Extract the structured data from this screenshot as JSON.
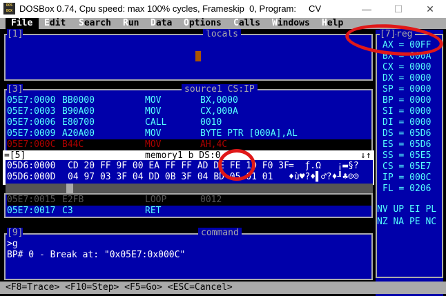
{
  "window": {
    "icon_text": "DOS BOX",
    "title": "DOSBox 0.74, Cpu speed: max 100% cycles, Frameskip  0, Program:     CV",
    "minimize_glyph": "—",
    "maximize_glyph": "☐",
    "close_glyph": "✕"
  },
  "menu": [
    {
      "hot": "F",
      "rest": "ile"
    },
    {
      "hot": "E",
      "rest": "dit"
    },
    {
      "hot": "S",
      "rest": "earch"
    },
    {
      "hot": "R",
      "rest": "un"
    },
    {
      "hot": "D",
      "rest": "ata"
    },
    {
      "hot": "O",
      "rest": "ptions"
    },
    {
      "hot": "C",
      "rest": "alls"
    },
    {
      "hot": "W",
      "rest": "indows"
    },
    {
      "hot": "H",
      "rest": "elp"
    }
  ],
  "locals": {
    "number": "[1]",
    "title": "locals"
  },
  "source": {
    "number": "[3]",
    "title": "source1 CS:IP",
    "lines": [
      {
        "addr": "05E7:0000",
        "bytes": "BB0000",
        "op": "MOV",
        "args": "BX,0000"
      },
      {
        "addr": "05E7:0003",
        "bytes": "B90A00",
        "op": "MOV",
        "args": "CX,000A"
      },
      {
        "addr": "05E7:0006",
        "bytes": "E80700",
        "op": "CALL",
        "args": "0010"
      },
      {
        "addr": "05E7:0009",
        "bytes": "A20A00",
        "op": "MOV",
        "args": "BYTE PTR [000A],AL"
      },
      {
        "addr": "05E7:000C",
        "bytes": "B44C",
        "op": "MOV",
        "args": "AH,4C"
      }
    ],
    "lines_after": [
      {
        "addr": "05E7:0015",
        "bytes": "E2FB",
        "op": "LOOP",
        "args": "0012"
      },
      {
        "addr": "05E7:0017",
        "bytes": "C3",
        "op": "RET",
        "args": ""
      }
    ]
  },
  "memory": {
    "number": "=[5]",
    "title": "memory1 b DS:0",
    "scroll": "↓↑",
    "lines": [
      {
        "addr": "05D6:0000",
        "hex": "CD 20 FF 9F 00 EA FF FF AD DE FE 1D F0 3F",
        "ascii": "=  ƒ.Ω   ¡▬§?"
      },
      {
        "addr": "05D6:000D",
        "hex": "04 97 03 3F 04 DD 0B 3F 04 BD 05 01 01",
        "ascii": "♦ù♥?♦▌♂?♦╜♣☺☺"
      }
    ]
  },
  "registers": {
    "number": "[7]",
    "title": "reg",
    "items": [
      {
        "name": "AX",
        "value": "00FF"
      },
      {
        "name": "BX",
        "value": "000A"
      },
      {
        "name": "CX",
        "value": "0000"
      },
      {
        "name": "DX",
        "value": "0000"
      },
      {
        "name": "SP",
        "value": "0000"
      },
      {
        "name": "BP",
        "value": "0000"
      },
      {
        "name": "SI",
        "value": "0000"
      },
      {
        "name": "DI",
        "value": "0000"
      },
      {
        "name": "DS",
        "value": "05D6"
      },
      {
        "name": "ES",
        "value": "05D6"
      },
      {
        "name": "SS",
        "value": "05E5"
      },
      {
        "name": "CS",
        "value": "05E7"
      },
      {
        "name": "IP",
        "value": "000C"
      },
      {
        "name": "FL",
        "value": "0206"
      }
    ],
    "flags_row1": "NV UP EI PL",
    "flags_row2": "NZ NA PE NC"
  },
  "command": {
    "number": "[9]",
    "title": "command",
    "lines": [
      ">g",
      "BP# 0 - Break at: \"0x05E7:0x000C\""
    ]
  },
  "status_bar": "<F8=Trace> <F10=Step> <F5=Go> <ESC=Cancel>",
  "colors": {
    "panel_blue": "#0000aa",
    "text_cyan": "#55ffff",
    "menu_gray": "#aaaaaa",
    "highlight_red": "#aa0000",
    "annotation_red": "#e01818"
  }
}
